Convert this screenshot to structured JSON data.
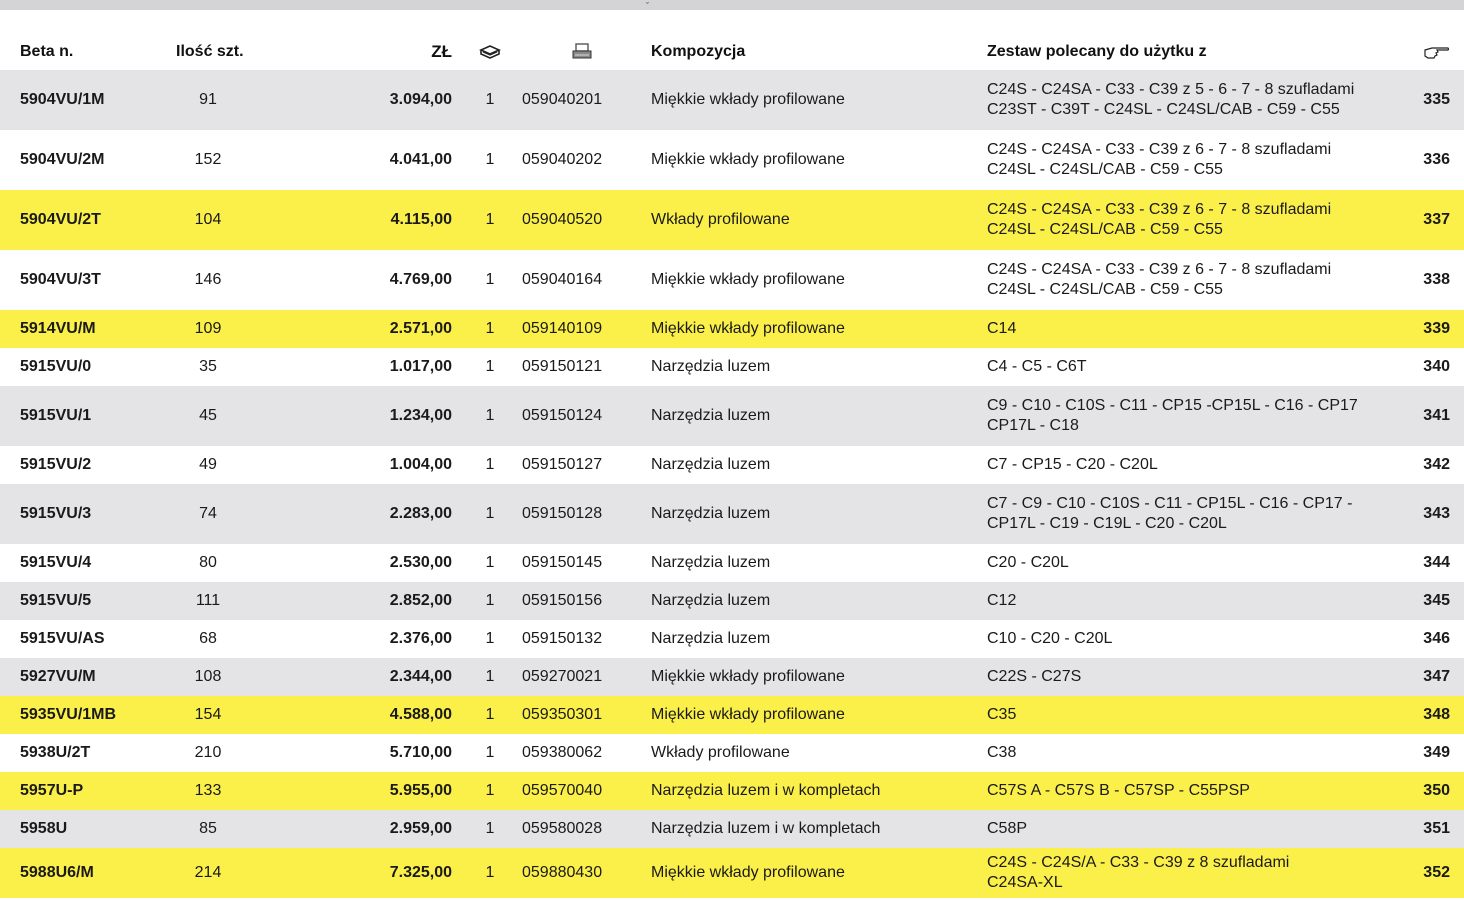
{
  "header": {
    "code": "Beta n.",
    "qty": "Ilość szt.",
    "price": "ZŁ",
    "composition": "Kompozycja",
    "recommended": "Zestaw polecany do użytku z",
    "pack_icon": "package-icon",
    "ean_icon": "barcode-printer-icon",
    "page_icon": "pointing-hand-icon"
  },
  "top_mark": "ˇ",
  "colors": {
    "grey": "#e4e4e6",
    "yellow": "#fbf04a",
    "white": "#ffffff"
  },
  "rows": [
    {
      "code": "5904VU/1M",
      "qty": "91",
      "price": "3.094,00",
      "pack": "1",
      "ean": "059040201",
      "komp": "Miękkie wkłady profilowane",
      "z1": "C24S - C24SA - C33 - C39 z 5 - 6 - 7 - 8 szufladami",
      "z2": "C23ST - C39T - C24SL - C24SL/CAB - C59 - C55",
      "page": "335",
      "bg": "grey"
    },
    {
      "code": "5904VU/2M",
      "qty": "152",
      "price": "4.041,00",
      "pack": "1",
      "ean": "059040202",
      "komp": "Miękkie wkłady profilowane",
      "z1": "C24S - C24SA - C33 - C39 z 6 - 7 - 8 szufladami",
      "z2": "C24SL - C24SL/CAB - C59 - C55",
      "page": "336",
      "bg": "white"
    },
    {
      "code": "5904VU/2T",
      "qty": "104",
      "price": "4.115,00",
      "pack": "1",
      "ean": "059040520",
      "komp": "Wkłady profilowane",
      "z1": "C24S - C24SA - C33 - C39 z 6 - 7 - 8 szufladami",
      "z2": "C24SL - C24SL/CAB - C59 - C55",
      "page": "337",
      "bg": "yellow"
    },
    {
      "code": "5904VU/3T",
      "qty": "146",
      "price": "4.769,00",
      "pack": "1",
      "ean": "059040164",
      "komp": "Miękkie wkłady profilowane",
      "z1": "C24S - C24SA - C33 - C39 z 6 - 7 - 8 szufladami",
      "z2": "C24SL - C24SL/CAB - C59 - C55",
      "page": "338",
      "bg": "white"
    },
    {
      "code": "5914VU/M",
      "qty": "109",
      "price": "2.571,00",
      "pack": "1",
      "ean": "059140109",
      "komp": "Miękkie wkłady profilowane",
      "z1": "C14",
      "z2": "",
      "page": "339",
      "bg": "yellow"
    },
    {
      "code": "5915VU/0",
      "qty": "35",
      "price": "1.017,00",
      "pack": "1",
      "ean": "059150121",
      "komp": "Narzędzia luzem",
      "z1": "C4 - C5 - C6T",
      "z2": "",
      "page": "340",
      "bg": "white"
    },
    {
      "code": "5915VU/1",
      "qty": "45",
      "price": "1.234,00",
      "pack": "1",
      "ean": "059150124",
      "komp": "Narzędzia luzem",
      "z1": "C9 - C10 - C10S - C11 - CP15 -CP15L - C16 - CP17",
      "z2": "CP17L - C18",
      "page": "341",
      "bg": "grey"
    },
    {
      "code": "5915VU/2",
      "qty": "49",
      "price": "1.004,00",
      "pack": "1",
      "ean": "059150127",
      "komp": "Narzędzia luzem",
      "z1": "C7 - CP15 - C20 - C20L",
      "z2": "",
      "page": "342",
      "bg": "white"
    },
    {
      "code": "5915VU/3",
      "qty": "74",
      "price": "2.283,00",
      "pack": "1",
      "ean": "059150128",
      "komp": "Narzędzia luzem",
      "z1": "C7 - C9 - C10 - C10S - C11 - CP15L - C16 - CP17 -",
      "z2": "CP17L - C19 - C19L - C20 - C20L",
      "page": "343",
      "bg": "grey"
    },
    {
      "code": "5915VU/4",
      "qty": "80",
      "price": "2.530,00",
      "pack": "1",
      "ean": "059150145",
      "komp": "Narzędzia luzem",
      "z1": "C20 - C20L",
      "z2": "",
      "page": "344",
      "bg": "white"
    },
    {
      "code": "5915VU/5",
      "qty": "111",
      "price": "2.852,00",
      "pack": "1",
      "ean": "059150156",
      "komp": "Narzędzia luzem",
      "z1": "C12",
      "z2": "",
      "page": "345",
      "bg": "grey"
    },
    {
      "code": "5915VU/AS",
      "qty": "68",
      "price": "2.376,00",
      "pack": "1",
      "ean": "059150132",
      "komp": "Narzędzia luzem",
      "z1": "C10 - C20 - C20L",
      "z2": "",
      "page": "346",
      "bg": "white"
    },
    {
      "code": "5927VU/M",
      "qty": "108",
      "price": "2.344,00",
      "pack": "1",
      "ean": "059270021",
      "komp": "Miękkie wkłady profilowane",
      "z1": "C22S - C27S",
      "z2": "",
      "page": "347",
      "bg": "grey"
    },
    {
      "code": "5935VU/1MB",
      "qty": "154",
      "price": "4.588,00",
      "pack": "1",
      "ean": "059350301",
      "komp": "Miękkie wkłady profilowane",
      "z1": "C35",
      "z2": "",
      "page": "348",
      "bg": "yellow"
    },
    {
      "code": "5938U/2T",
      "qty": "210",
      "price": "5.710,00",
      "pack": "1",
      "ean": "059380062",
      "komp": "Wkłady profilowane",
      "z1": "C38",
      "z2": "",
      "page": "349",
      "bg": "white"
    },
    {
      "code": "5957U-P",
      "qty": "133",
      "price": "5.955,00",
      "pack": "1",
      "ean": "059570040",
      "komp": "Narzędzia luzem i w kompletach",
      "z1": "C57S A - C57S B - C57SP - C55PSP",
      "z2": "",
      "page": "350",
      "bg": "yellow"
    },
    {
      "code": "5958U",
      "qty": "85",
      "price": "2.959,00",
      "pack": "1",
      "ean": "059580028",
      "komp": "Narzędzia luzem i w kompletach",
      "z1": "C58P",
      "z2": "",
      "page": "351",
      "bg": "grey"
    },
    {
      "code": "5988U6/M",
      "qty": "214",
      "price": "7.325,00",
      "pack": "1",
      "ean": "059880430",
      "komp": "Miękkie wkłady profilowane",
      "z1": "C24S - C24S/A - C33 - C39 z  8 szufladami",
      "z2": "C24SA-XL",
      "page": "352",
      "bg": "yellow"
    }
  ]
}
